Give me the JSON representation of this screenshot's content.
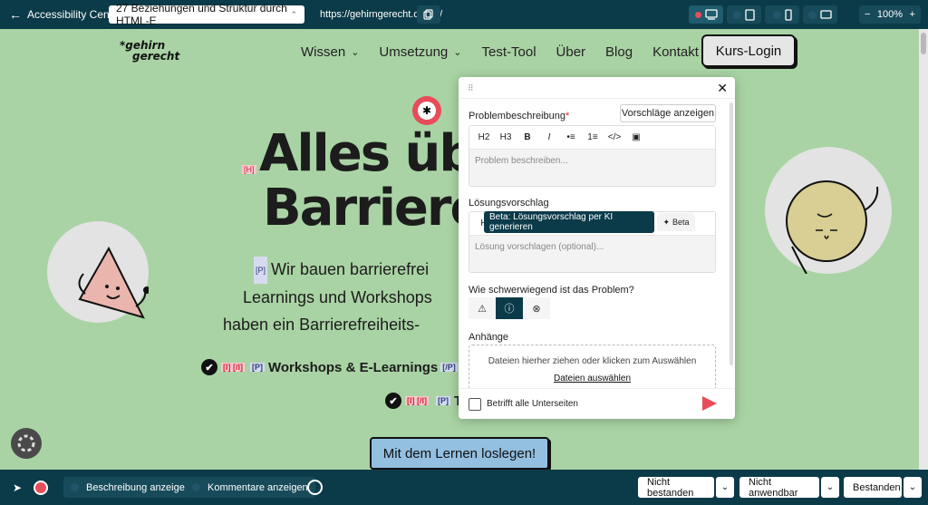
{
  "topbar": {
    "back_label": "Accessibility Center",
    "page_select": "27 Beziehungen und Struktur durch HTML-E",
    "url": "https://gehirngerecht.digital/",
    "zoom": "100%",
    "zoom_minus": "−",
    "zoom_plus": "+"
  },
  "site": {
    "logo_line1": "*gehirn",
    "logo_line2": "gerecht",
    "nav": [
      {
        "label": "Wissen"
      },
      {
        "label": "Umsetzung"
      },
      {
        "label": "Test-Tool"
      },
      {
        "label": "Über"
      },
      {
        "label": "Blog"
      },
      {
        "label": "Kontakt"
      }
    ],
    "kurs_login": "Kurs-Login",
    "h1_tag": "[H]",
    "title_line1": "Alles übe",
    "title_line2": "Barriere",
    "p_tag": "[P]",
    "i_tag": "[I] [/I]",
    "hero_line1": "Wir bauen barrierefrei",
    "hero_line2": "Learnings und Workshops",
    "hero_line3": "haben ein Barrierefreiheits-",
    "check1_text": "Workshops & E-Learnings",
    "check1_end_tag": "[/P]",
    "check2_text": "T",
    "cta": "Mit dem Lernen loslegen!"
  },
  "panel": {
    "problem_label": "Problembeschreibung",
    "required_mark": "*",
    "suggest_button": "Vorschläge anzeigen",
    "problem_placeholder": "Problem beschreiben...",
    "solution_label": "Lösungsvorschlag",
    "solution_toolbar_h": "H",
    "tooltip": "Beta: Lösungsvorschlag per KI generieren",
    "beta_label": "Beta",
    "solution_placeholder": "Lösung vorschlagen (optional)...",
    "severity_label": "Wie schwerwiegend ist das Problem?",
    "attachments_label": "Anhänge",
    "dropzone_text": "Dateien hierher ziehen oder klicken zum Auswählen",
    "dropzone_link": "Dateien auswählen",
    "all_pages_label": "Betrifft alle Unterseiten",
    "toolbar": [
      "H2",
      "H3",
      "B",
      "I",
      "•≡",
      "1≡",
      "</>",
      "▣"
    ]
  },
  "bottombar": {
    "show_description": "Beschreibung anzeigen",
    "show_comments": "Kommentare anzeigen",
    "failed": "Nicht bestanden",
    "not_applicable": "Nicht anwendbar",
    "passed": "Bestanden"
  },
  "colors": {
    "bar": "#0b3a48",
    "site_bg": "#a9d3a4",
    "accent": "#e84c5a",
    "cta": "#93bfe0"
  },
  "icons": [
    "arrow-left-icon",
    "copy-icon",
    "desktop-icon",
    "tablet-icon",
    "phone-icon",
    "landscape-icon",
    "bug-icon",
    "close-icon",
    "drag-icon",
    "warning-icon",
    "info-icon",
    "error-icon",
    "sparkle-icon",
    "send-icon",
    "cursor-icon",
    "record-icon",
    "chevron-down-icon"
  ]
}
